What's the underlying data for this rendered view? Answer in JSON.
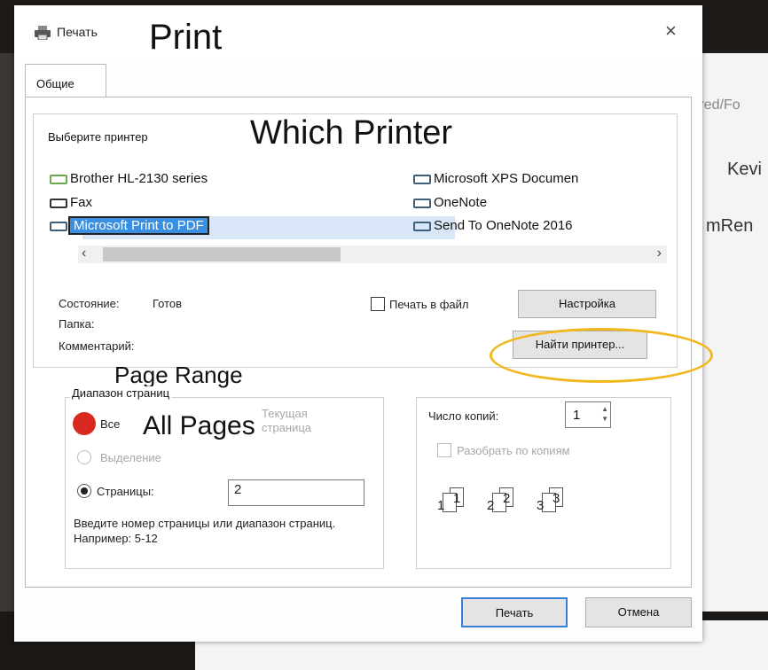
{
  "background": {
    "right_partial_texts": [
      "lared/Fo",
      "Kevi",
      "mRen"
    ]
  },
  "dialog": {
    "title": "Печать",
    "close_glyph": "×",
    "annotations": {
      "print": "Print",
      "which_printer": "Which Printer",
      "page_range": "Page Range",
      "all_pages": "All Pages"
    },
    "tab": "Общие",
    "printer_group_label": "Выберите принтер",
    "printers": [
      {
        "name": "Brother HL-2130 series",
        "selected": false
      },
      {
        "name": "Microsoft XPS Documen",
        "selected": false
      },
      {
        "name": "Fax",
        "selected": false
      },
      {
        "name": "OneNote",
        "selected": false
      },
      {
        "name": "Microsoft Print to PDF",
        "selected": true
      },
      {
        "name": "Send To OneNote 2016",
        "selected": false
      }
    ],
    "scroll": {
      "left": "‹",
      "right": "›"
    },
    "status_label": "Состояние:",
    "status_value": "Готов",
    "folder_label": "Папка:",
    "comment_label": "Комментарий:",
    "print_to_file_label": "Печать в файл",
    "preferences_button": "Настройка",
    "find_printer_button": "Найти принтер...",
    "range": {
      "group_label": "Диапазон страниц",
      "all_label": "Все",
      "current_page_label": "Текущая страница",
      "selection_label": "Выделение",
      "pages_label": "Страницы:",
      "pages_value": "2",
      "hint": "Введите номер страницы или диапазон страниц.  Например: 5-12"
    },
    "copies": {
      "label": "Число копий:",
      "value": "1",
      "collate_label": "Разобрать по копиям",
      "collate_pages": [
        "1",
        "1",
        "2",
        "2",
        "3",
        "3"
      ]
    },
    "print_button": "Печать",
    "cancel_button": "Отмена"
  },
  "colors": {
    "highlight_ring": "#f1b81e",
    "selected_printer": "#3a8fe0",
    "red_marker": "#d8281f"
  }
}
